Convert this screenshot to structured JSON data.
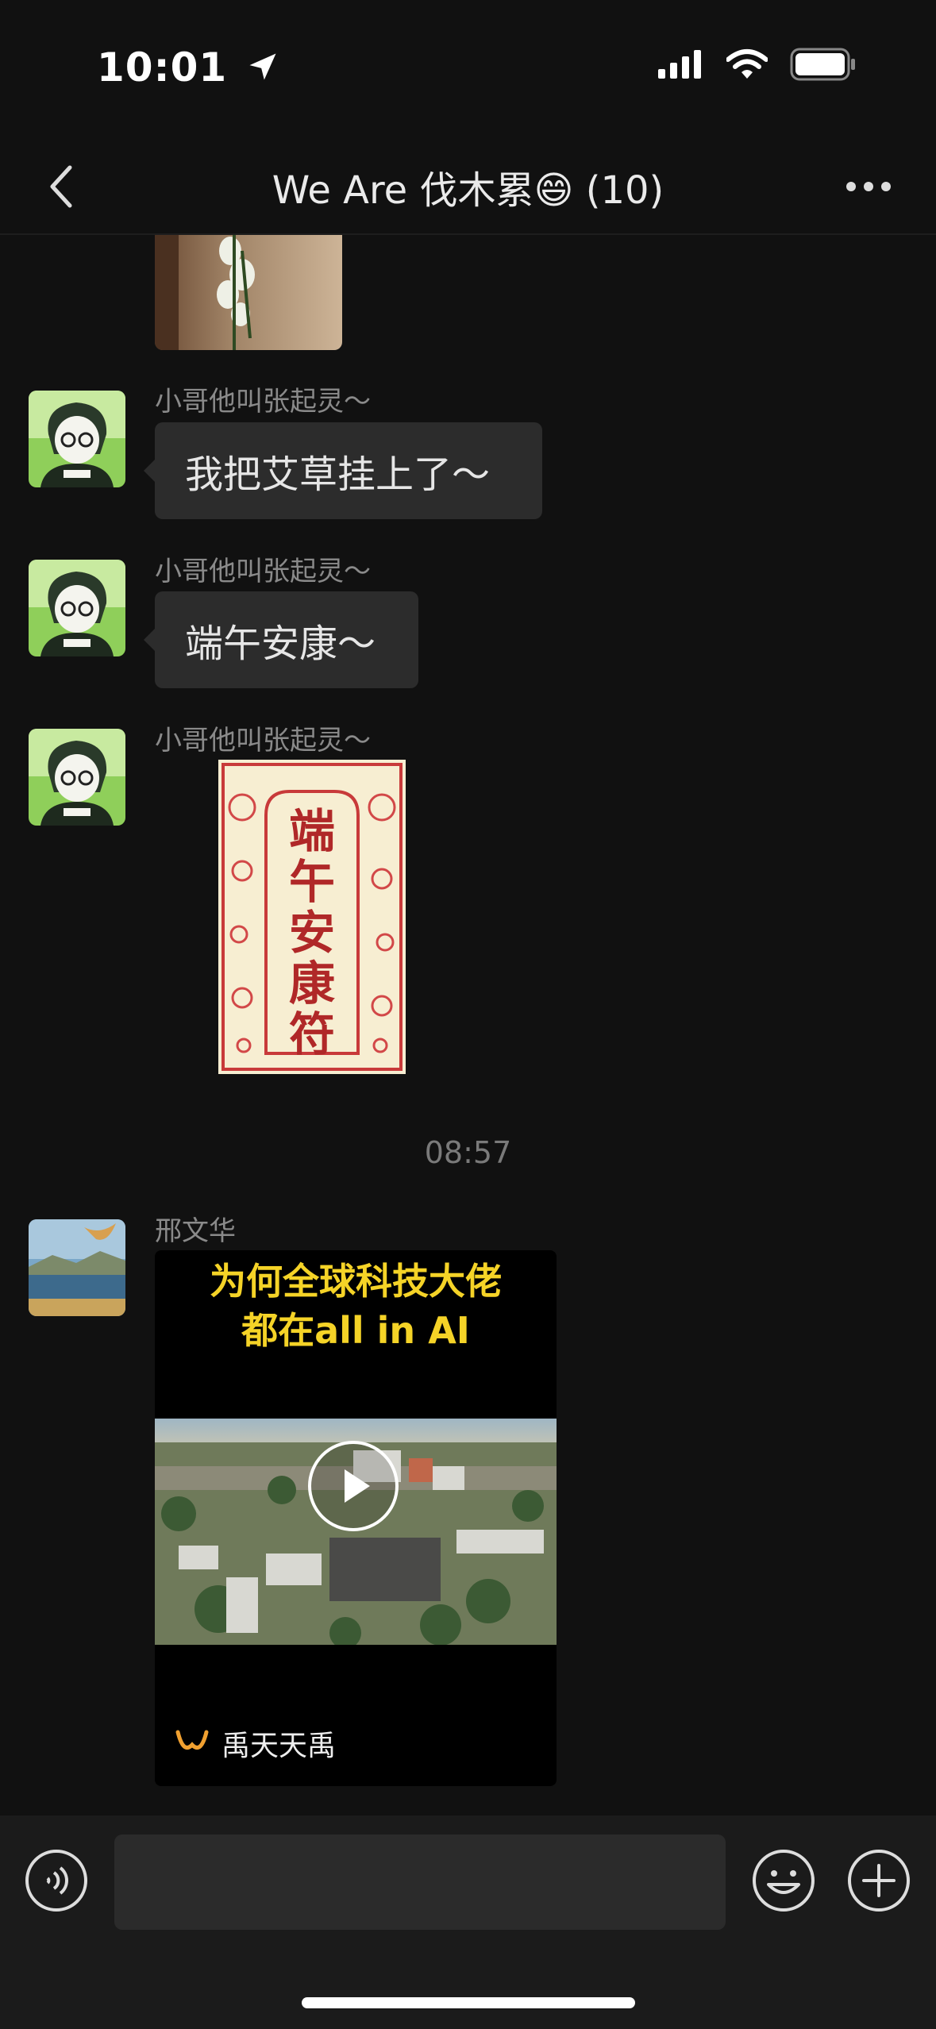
{
  "status_bar": {
    "time": "10:01"
  },
  "nav": {
    "title": "We Are 伐木累😄 (10)"
  },
  "messages": [
    {
      "sender": "小哥他叫张起灵～",
      "text": "我把艾草挂上了～"
    },
    {
      "sender": "小哥他叫张起灵～",
      "text": "端午安康～"
    },
    {
      "sender": "小哥他叫张起灵～",
      "sticker_text": "端午安康符"
    }
  ],
  "timestamp": "08:57",
  "video_message": {
    "sender": "邢文华",
    "title_line1": "为何全球科技大佬",
    "title_line2": "都在all in AI",
    "channel": "禹天天禹"
  },
  "colors": {
    "background": "#111111",
    "bubble": "#2c2c2c",
    "video_title": "#f5d327",
    "channel_icon": "#f0a030"
  }
}
